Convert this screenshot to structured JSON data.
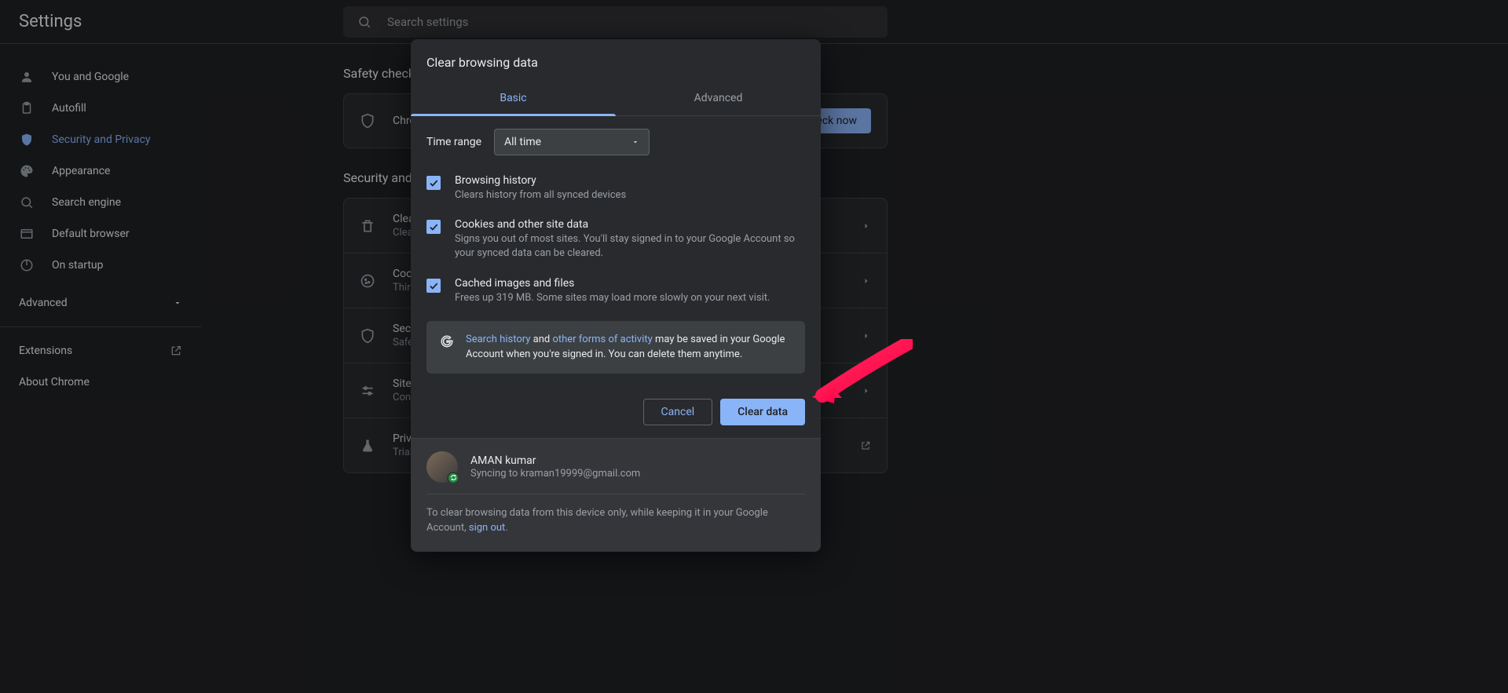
{
  "header": {
    "title": "Settings",
    "search_placeholder": "Search settings"
  },
  "sidebar": {
    "items": [
      {
        "label": "You and Google"
      },
      {
        "label": "Autofill"
      },
      {
        "label": "Security and Privacy"
      },
      {
        "label": "Appearance"
      },
      {
        "label": "Search engine"
      },
      {
        "label": "Default browser"
      },
      {
        "label": "On startup"
      }
    ],
    "advanced": "Advanced",
    "extensions": "Extensions",
    "about": "About Chrome"
  },
  "main": {
    "safety_title": "Safety check",
    "safety_text": "Chrome can help keep you safe from data breaches, bad extensions, and more",
    "check_now": "Check now",
    "security_title": "Security and Privacy",
    "rows": [
      {
        "title": "Clear browsing data",
        "sub": "Clear history, cookies, cache, and more"
      },
      {
        "title": "Cookies and other site data",
        "sub": "Third-party cookies are blocked in Incognito mode"
      },
      {
        "title": "Security",
        "sub": "Safe Browsing (protection from dangerous sites) and other security settings"
      },
      {
        "title": "Site Settings",
        "sub": "Controls what information sites can use and show (location, camera, pop-ups, and more)"
      },
      {
        "title": "Privacy Sandbox",
        "sub": "Trial features are on"
      }
    ]
  },
  "dialog": {
    "title": "Clear browsing data",
    "tabs": {
      "basic": "Basic",
      "advanced": "Advanced"
    },
    "time_range_label": "Time range",
    "time_range_value": "All time",
    "items": [
      {
        "title": "Browsing history",
        "sub": "Clears history from all synced devices"
      },
      {
        "title": "Cookies and other site data",
        "sub": "Signs you out of most sites. You'll stay signed in to your Google Account so your synced data can be cleared."
      },
      {
        "title": "Cached images and files",
        "sub": "Frees up 319 MB. Some sites may load more slowly on your next visit."
      }
    ],
    "info": {
      "link1": "Search history",
      "middle1": " and ",
      "link2": "other forms of activity",
      "rest": " may be saved in your Google Account when you're signed in. You can delete them anytime."
    },
    "cancel": "Cancel",
    "clear": "Clear data",
    "profile": {
      "name": "AMAN kumar",
      "sync": "Syncing to kraman19999@gmail.com"
    },
    "footer": {
      "text1": "To clear browsing data from this device only, while keeping it in your Google Account, ",
      "signout": "sign out",
      "text2": "."
    }
  }
}
